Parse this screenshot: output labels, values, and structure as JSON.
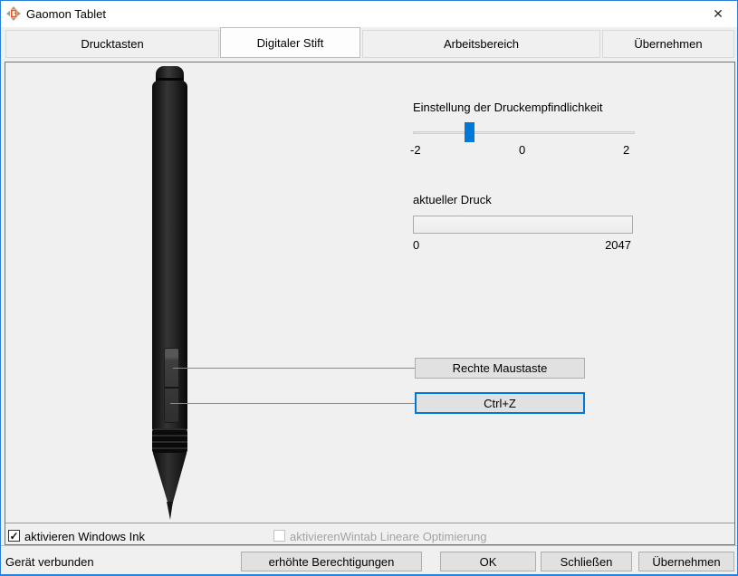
{
  "window": {
    "title": "Gaomon Tablet",
    "close_icon": "✕",
    "status": "Gerät verbunden"
  },
  "tabs": {
    "drucktasten": "Drucktasten",
    "digitaler_stift": "Digitaler Stift",
    "arbeitsbereich": "Arbeitsbereich",
    "uebernehmen": "Übernehmen",
    "active_tab": "Digitaler Stift"
  },
  "pressure_section": {
    "sensitivity_label": "Einstellung der Druckempfindlichkeit",
    "scale": {
      "min": "-2",
      "mid": "0",
      "max": "2"
    },
    "slider_value": -1,
    "slider_range": [
      -2,
      2
    ],
    "current_pressure_label": "aktueller Druck",
    "pressure_min": "0",
    "pressure_max": "2047",
    "current_pressure_value": 0
  },
  "pen_button_assignments": {
    "upper": "Rechte Maustaste",
    "lower": "Ctrl+Z",
    "focused": "Ctrl+Z"
  },
  "options": {
    "windows_ink": {
      "label": "aktivieren Windows Ink",
      "checked": true,
      "check_glyph": "✓"
    },
    "wintab": {
      "label": "aktivierenWintab Lineare Optimierung",
      "checked": false,
      "enabled": false
    }
  },
  "footer_buttons": {
    "elevated": "erhöhte Berechtigungen",
    "ok": "OK",
    "close": "Schließen",
    "apply": "Übernehmen"
  },
  "colors": {
    "accent": "#0078d7",
    "window_border": "#2a7fd6",
    "pen_body": "#1e1e1e"
  }
}
